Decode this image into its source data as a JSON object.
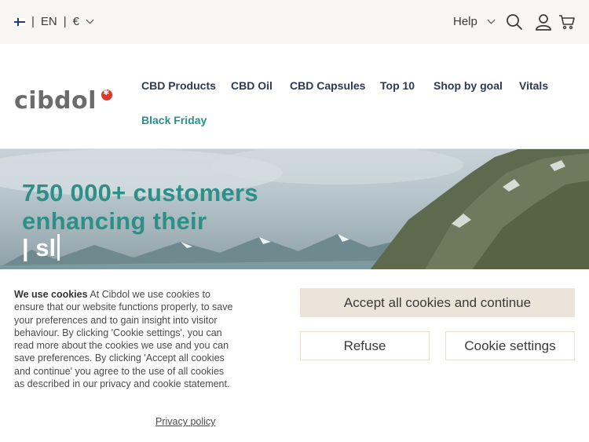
{
  "topbar": {
    "language": "EN",
    "currency": "€",
    "help_label": "Help"
  },
  "nav": {
    "logo_text": "cibdol",
    "items": [
      {
        "label": "CBD Products"
      },
      {
        "label": "CBD Oil"
      },
      {
        "label": "CBD Capsules"
      },
      {
        "label": "Top 10"
      },
      {
        "label": "Shop by goal"
      },
      {
        "label": "Vitals"
      },
      {
        "label": "Black Friday"
      }
    ]
  },
  "hero": {
    "line1": "750 000+ customers",
    "line2": "enhancing their",
    "typing": "| sl"
  },
  "cookie": {
    "heading": "We use cookies",
    "body": " At Cibdol we use cookies to ensure that our website functions properly, to save your preferences and to gain insight into visitor behaviour. By clicking 'Cookie settings', you can read more about the cookies we use and you can save preferences. By clicking 'Accept all cookies and continue' you agree to the use of all cookies as described in our privacy and cookie statement.",
    "privacy_link": "Privacy policy",
    "accept_label": "Accept all cookies and continue",
    "refuse_label": "Refuse",
    "settings_label": "Cookie settings"
  },
  "colors": {
    "accent": "#2d8f86",
    "nav_text": "#2b3a55",
    "topbar_bg": "#f7f6f2",
    "button_primary_bg": "#ece4d8"
  },
  "icons": [
    "flag-fi-icon",
    "chevron-down-icon",
    "search-icon",
    "user-icon",
    "cart-icon"
  ]
}
